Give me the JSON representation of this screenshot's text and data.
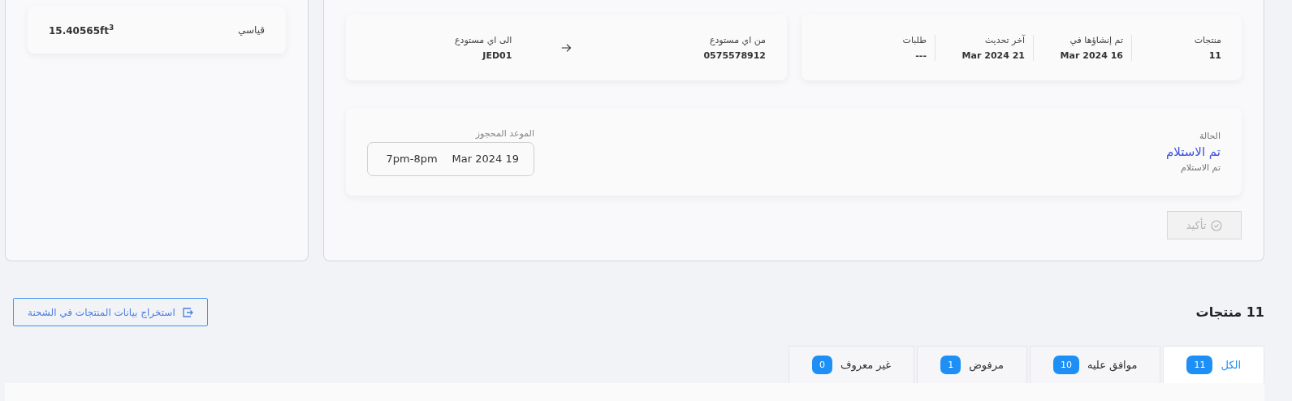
{
  "volume": {
    "label": "قياسي",
    "value": "15.40565ft$^{3}$"
  },
  "stats": [
    {
      "label": "منتجات",
      "value": "11"
    },
    {
      "label": "تم إنشاؤها في",
      "value": "Mar 2024 16"
    },
    {
      "label": "آخر تحديث",
      "value": "Mar 2024 21"
    },
    {
      "label": "طلبات",
      "value": "---"
    }
  ],
  "transfer": {
    "from": {
      "label": "من اي مستودع",
      "value": "0575578912"
    },
    "to": {
      "label": "الى اي مستودع",
      "value": "JED01"
    }
  },
  "status": {
    "label": "الحالة",
    "value": "تم الاستلام",
    "note": "تم الاستلام"
  },
  "appointment": {
    "label": "الموعد المحجوز",
    "date": "Mar 2024 19",
    "time": "7pm-8pm"
  },
  "confirm_button": {
    "label": "تأكيد",
    "disabled": true
  },
  "products_heading": "11 منتجات",
  "export_button": {
    "label": "استخراج بيانات المنتجات في الشحنة"
  },
  "tabs": [
    {
      "label": "الكل",
      "count": "11",
      "selected": true
    },
    {
      "label": "موافق عليه",
      "count": "10",
      "selected": false
    },
    {
      "label": "مرفوض",
      "count": "1",
      "selected": false
    },
    {
      "label": "غير معروف",
      "count": "0",
      "selected": false
    }
  ]
}
